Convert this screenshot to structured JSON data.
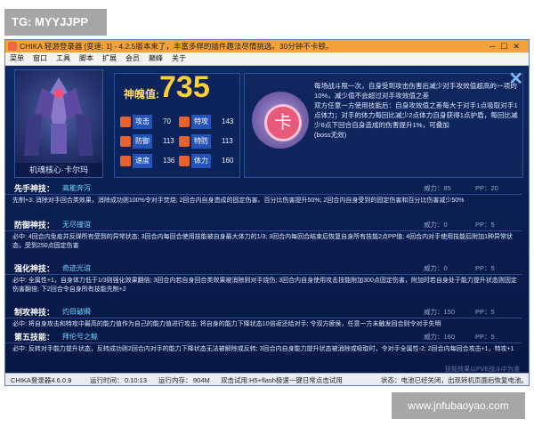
{
  "watermarks": {
    "top_left": "TG: MYYJJPP",
    "bottom_right": "www.jnfubaoyao.com"
  },
  "window": {
    "title": "CHIKA 轻游登录器 [变速: 1] - 4.2.5版本来了，丰富多样的插件趣法尽情挑选。30分钟不卡顿。",
    "menu": [
      "菜单",
      "窗口",
      "工具",
      "脚本",
      "扩展",
      "会员",
      "巅峰",
      "关于"
    ]
  },
  "pet": {
    "name": "机魂核心·卡尔玛",
    "power_label": "神魄值:",
    "power_value": "735",
    "stats": [
      {
        "label": "攻击",
        "value": "70",
        "icon": "attack-icon",
        "color": "#e6622e"
      },
      {
        "label": "特攻",
        "value": "143",
        "icon": "sp-attack-icon",
        "color": "#e6622e"
      },
      {
        "label": "防御",
        "value": "113",
        "icon": "defense-icon",
        "color": "#e6622e"
      },
      {
        "label": "特防",
        "value": "113",
        "icon": "sp-defense-icon",
        "color": "#e6622e"
      },
      {
        "label": "速度",
        "value": "136",
        "icon": "speed-icon",
        "color": "#e6622e"
      },
      {
        "label": "体力",
        "value": "160",
        "icon": "hp-icon",
        "color": "#e6622e"
      }
    ]
  },
  "ability": {
    "icon": "card-icon",
    "text": "每场战斗限一次，自身受到攻击伤害后减少对手攻效值超高的一项的10%，减少值不会超过对手攻效值之差\n双方任意一方使用技能后：自身攻效值之差每大于对手1点吸取对手1点体力；对手的体力每回比减少2点体力自身获得1点护盾，每回比减少8点下回合自身造成的伤害提升1%，可叠加\n(boss无效)"
  },
  "skills": [
    {
      "name": "先手神技：",
      "sub": "高能奔泻",
      "power": "威力：85",
      "pp": "PP：20",
      "desc": "先制+3: 消除对手回合类效果，消除成功则100%令对手焚烧; 2回合内自身造成的固定伤害、百分比伤害提升50%; 2回合内自身受到的固定伤害和百分比伤害减少50%"
    },
    {
      "name": "防御神技：",
      "sub": "无尽撞谊",
      "power": "威力：0",
      "pp": "PP：5",
      "desc": "必中: 4回合内免疫并反弹所有受到的异常状态; 3回合内每回合使用技能被自身最大体力的1/3; 3回合内每回合结束后恢复自身所有技能2点PP值; 4回合内对手使用技能后附加1种异常状态，受到250点固定伤害"
    },
    {
      "name": "强化神技：",
      "sub": "奇迹光谊",
      "power": "威力：0",
      "pp": "PP：5",
      "desc": "必中: 全属性+1，自身体力低于1/3则强化效果翻倍; 3回合内若自身回合类效果被消除则对手烧伤; 3回合内自身使用攻击技能附加300点固定伤害，附加时若自身处于能力提升状态则固定伤害翻倍; 下2回合令自身所有技能先制+2"
    },
    {
      "name": "制攻神技：",
      "sub": "灼目破瞬",
      "power": "威力：150",
      "pp": "PP：5",
      "desc": "必中: 将自身攻击和特攻中最高的能力值作为自己的能力值进行攻击; 将自身的能力下降状态10倍返还给对手; 令双方疲侯，任意一方未触发回合则令对手失明"
    },
    {
      "name": "第五技能：",
      "sub": "拜伦号之鲸",
      "power": "威力：160",
      "pp": "PP：5",
      "desc": "必中: 反转对手能力提升状态，反转成功则2回合内对手的能力下降状态无法被解除或反转; 3回合内自身能力提升状态被消除或吸取时，令对手全属性-2; 2回合内每回合攻击+1，特攻+1"
    }
  ],
  "footer_hint": "技能效果以PVE战斗中为准",
  "status": {
    "version": "CHIKA登录器4.6.0.9",
    "runtime_label": "运行时间：",
    "runtime": "0:10:13",
    "memory_label": "运行内存：",
    "memory": "904M",
    "tip": "双击试用:H5+flash极速一键日常点击试用",
    "right": "状态：电池已经关闭，出现转机页面后恢复电池。"
  }
}
